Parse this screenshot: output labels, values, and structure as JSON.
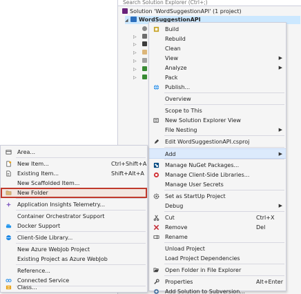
{
  "solution_explorer": {
    "search_placeholder": "Search Solution Explorer (Ctrl+;)",
    "solution_label": "Solution 'WordSuggestionAPI' (1 project)",
    "project_label": "WordSuggestionAPI"
  },
  "context_menu": {
    "items": [
      {
        "label": "Build",
        "icon": "build-icon"
      },
      {
        "label": "Rebuild",
        "icon": ""
      },
      {
        "label": "Clean",
        "icon": ""
      },
      {
        "label": "View",
        "icon": "",
        "submenu": true
      },
      {
        "label": "Analyze",
        "icon": "",
        "submenu": true
      },
      {
        "label": "Pack",
        "icon": ""
      },
      {
        "label": "Publish...",
        "icon": "globe-icon"
      },
      {
        "label": "Overview",
        "icon": ""
      },
      {
        "label": "Scope to This",
        "icon": ""
      },
      {
        "label": "New Solution Explorer View",
        "icon": "new-view-icon"
      },
      {
        "label": "File Nesting",
        "icon": "",
        "submenu": true
      },
      {
        "label": "Edit WordSuggestionAPI.csproj",
        "icon": "edit-icon"
      },
      {
        "label": "Add",
        "icon": "",
        "submenu": true
      },
      {
        "label": "Manage NuGet Packages...",
        "icon": "nuget-icon"
      },
      {
        "label": "Manage Client-Side Libraries...",
        "icon": "library-icon"
      },
      {
        "label": "Manage User Secrets",
        "icon": ""
      },
      {
        "label": "Set as StartUp Project",
        "icon": "gear-icon"
      },
      {
        "label": "Debug",
        "icon": "",
        "submenu": true
      },
      {
        "label": "Cut",
        "icon": "cut-icon",
        "shortcut": "Ctrl+X"
      },
      {
        "label": "Remove",
        "icon": "remove-icon",
        "shortcut": "Del"
      },
      {
        "label": "Rename",
        "icon": "rename-icon"
      },
      {
        "label": "Unload Project",
        "icon": ""
      },
      {
        "label": "Load Project Dependencies",
        "icon": ""
      },
      {
        "label": "Open Folder in File Explorer",
        "icon": "open-folder-icon"
      },
      {
        "label": "Properties",
        "icon": "wrench-icon",
        "shortcut": "Alt+Enter"
      },
      {
        "label": "Add Solution to Subversion...",
        "icon": "subversion-icon"
      }
    ]
  },
  "add_submenu": {
    "items": [
      {
        "label": "Area...",
        "icon": "area-icon"
      },
      {
        "label": "New Item...",
        "icon": "new-item-icon",
        "shortcut": "Ctrl+Shift+A"
      },
      {
        "label": "Existing Item...",
        "icon": "existing-item-icon",
        "shortcut": "Shift+Alt+A"
      },
      {
        "label": "New Scaffolded Item...",
        "icon": ""
      },
      {
        "label": "New Folder",
        "icon": "folder-icon"
      },
      {
        "label": "Application Insights Telemetry...",
        "icon": "insights-icon"
      },
      {
        "label": "Container Orchestrator Support",
        "icon": ""
      },
      {
        "label": "Docker Support",
        "icon": "docker-icon"
      },
      {
        "label": "Client-Side Library...",
        "icon": "client-library-icon"
      },
      {
        "label": "New Azure WebJob Project",
        "icon": ""
      },
      {
        "label": "Existing Project as Azure WebJob",
        "icon": ""
      },
      {
        "label": "Reference...",
        "icon": ""
      },
      {
        "label": "Connected Service",
        "icon": "connected-service-icon"
      },
      {
        "label": "Class...",
        "icon": "class-icon"
      }
    ]
  },
  "colors": {
    "highlight": "#dceafc",
    "annotation_red": "#c0392b",
    "menu_bg": "#f5f5f5",
    "csharp_green": "#388a34"
  }
}
